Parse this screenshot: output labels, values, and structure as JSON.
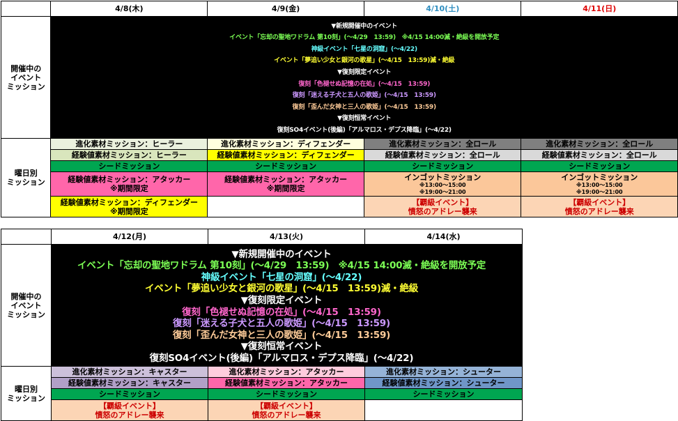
{
  "colors": {
    "holiday_sat": "#2e8ec0",
    "holiday_sun": "#dd0000",
    "event_white": "#ffffff",
    "event_green": "#7cff55",
    "event_cyan": "#66ffff",
    "event_yellow": "#ffff33",
    "event_pink": "#ff66cc",
    "event_lavender": "#cc99ff",
    "event_tan": "#ffcc99",
    "seed_bg": "#00a651",
    "healer_bg": "#ebf1de",
    "healer_bg2": "#d9e6bd",
    "defender_bg": "#ffffdd",
    "defender_bg2": "#ffff00",
    "attacker_bg": "#ff66aa",
    "attacker_bg_light": "#ffccdd",
    "all_bg": "#7f7f7f",
    "all_bg2": "#d9d9d9",
    "ingot_bg": "#fbc79a",
    "haki_bg": "#fcd5b5",
    "caster_bg": "#ccc0da",
    "caster_bg2": "#b1a0c7",
    "shooter_bg": "#95b3d7",
    "shooter_bg2": "#6f96c8"
  },
  "row_labels": {
    "events": "開催中の\nイベント\nミッション",
    "daily": "曜日別\nミッション"
  },
  "week1": {
    "dates": [
      {
        "text": "4/8(木)",
        "type": "weekday"
      },
      {
        "text": "4/9(金)",
        "type": "weekday"
      },
      {
        "text": "4/10(土)",
        "type": "sat"
      },
      {
        "text": "4/11(日)",
        "type": "sun"
      }
    ],
    "event_lines": [
      {
        "text": "▼新規開催中のイベント",
        "color": "white"
      },
      {
        "text": "イベント「忘却の聖地ワドラム 第10刻」(～4/29　13:59)　※4/15 14:00滅・絶級を開放予定",
        "color": "green"
      },
      {
        "text": "神級イベント「七星の洞窟」(～4/22)",
        "color": "cyan"
      },
      {
        "text": "イベント「夢追い少女と銀河の歌星」(～4/15　13:59)滅・絶級",
        "color": "yellow"
      },
      {
        "text": "▼復刻限定イベント",
        "color": "white"
      },
      {
        "text": "復刻「色褪せぬ記憶の在処」(～4/15　13:59)",
        "color": "pink"
      },
      {
        "text": "復刻「迷える子犬と五人の歌姫」(～4/15　13:59)",
        "color": "lavender"
      },
      {
        "text": "復刻「歪んだ女神と三人の歌姫」(～4/15　13:59)",
        "color": "tan"
      },
      {
        "text": "▼復刻恒常イベント",
        "color": "white"
      },
      {
        "text": "復刻SO4イベント(後編)「アルマロス・デプス降臨」(～4/22)",
        "color": "white"
      }
    ],
    "days": [
      {
        "evo": "進化素材ミッション：ヒーラー",
        "exp": "経験値素材ミッション：ヒーラー",
        "seed": "シードミッション",
        "m4": {
          "text": "経験値素材ミッション：アタッカー",
          "note": "※期間限定"
        },
        "m5": {
          "text": "経験値素材ミッション：ディフェンダー",
          "note": "※期間限定"
        }
      },
      {
        "evo": "進化素材ミッション：ディフェンダー",
        "exp": "経験値素材ミッション：ディフェンダー",
        "seed": "シードミッション",
        "m4": {
          "text": "経験値素材ミッション：アタッカー",
          "note": "※期間限定"
        },
        "m5": {
          "text": "",
          "note": ""
        }
      },
      {
        "evo": "進化素材ミッション：全ロール",
        "exp": "経験値素材ミッション：全ロール",
        "seed": "シードミッション",
        "m4": {
          "text": "インゴットミッション",
          "note1": "※13:00～15:00",
          "note2": "※19:00～21:00"
        },
        "m5": {
          "text": "【覇級イベント】",
          "note": "憤怒のアドレー襲来"
        }
      },
      {
        "evo": "進化素材ミッション：全ロール",
        "exp": "経験値素材ミッション：全ロール",
        "seed": "シードミッション",
        "m4": {
          "text": "インゴットミッション",
          "note1": "※13:00～15:00",
          "note2": "※19:00～21:00"
        },
        "m5": {
          "text": "【覇級イベント】",
          "note": "憤怒のアドレー襲来"
        }
      }
    ]
  },
  "week2": {
    "dates": [
      {
        "text": "4/12(月)",
        "type": "weekday"
      },
      {
        "text": "4/13(火)",
        "type": "weekday"
      },
      {
        "text": "4/14(水)",
        "type": "weekday"
      }
    ],
    "event_lines": [
      {
        "text": "▼新規開催中のイベント",
        "color": "white"
      },
      {
        "text": "イベント「忘却の聖地ワドラム 第10刻」(～4/29　13:59)　※4/15 14:00滅・絶級を開放予定",
        "color": "green"
      },
      {
        "text": "神級イベント「七星の洞窟」(～4/22)",
        "color": "cyan"
      },
      {
        "text": "イベント「夢追い少女と銀河の歌星」(～4/15　13:59)滅・絶級",
        "color": "yellow"
      },
      {
        "text": "▼復刻限定イベント",
        "color": "white"
      },
      {
        "text": "復刻「色褪せぬ記憶の在処」(～4/15　13:59)",
        "color": "pink"
      },
      {
        "text": "復刻「迷える子犬と五人の歌姫」(～4/15　13:59)",
        "color": "lavender"
      },
      {
        "text": "復刻「歪んだ女神と三人の歌姫」(～4/15　13:59)",
        "color": "tan"
      },
      {
        "text": "▼復刻恒常イベント",
        "color": "white"
      },
      {
        "text": "復刻SO4イベント(後編)「アルマロス・デプス降臨」(～4/22)",
        "color": "white"
      }
    ],
    "days": [
      {
        "evo": "進化素材ミッション：キャスター",
        "exp": "経験値素材ミッション：キャスター",
        "seed": "シードミッション",
        "m4": {
          "text": "【覇級イベント】",
          "note": "憤怒のアドレー襲来"
        }
      },
      {
        "evo": "進化素材ミッション：アタッカー",
        "exp": "経験値素材ミッション：アタッカー",
        "seed": "シードミッション",
        "m4": {
          "text": "【覇級イベント】",
          "note": "憤怒のアドレー襲来"
        }
      },
      {
        "evo": "進化素材ミッション：シューター",
        "exp": "経験値素材ミッション：シューター",
        "seed": "シードミッション",
        "m4": {
          "text": "",
          "note": ""
        }
      }
    ]
  }
}
